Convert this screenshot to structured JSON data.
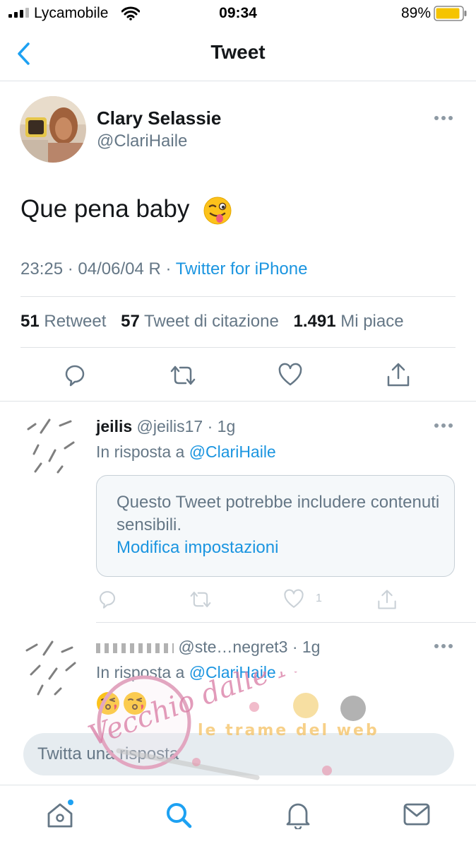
{
  "status_bar": {
    "carrier": "Lycamobile",
    "time": "09:34",
    "battery_percent": "89%",
    "battery_level": 0.89
  },
  "nav": {
    "title": "Tweet"
  },
  "tweet": {
    "author_name": "Clary Selassie",
    "author_handle": "@ClariHaile",
    "text": "Que pena baby",
    "emoji": "winking-face-with-tongue",
    "timestamp": "23:25 · 04/06/04 R · ",
    "source": "Twitter for iPhone",
    "stats": {
      "retweets_count": "51",
      "retweets_label": "Retweet",
      "quotes_count": "57",
      "quotes_label": "Tweet di citazione",
      "likes_count": "1.491",
      "likes_label": "Mi piace"
    }
  },
  "replies": [
    {
      "name": "jeilis",
      "handle_time": "@jeilis17 · 1g",
      "reply_prefix": "In risposta a ",
      "reply_to": "@ClariHaile",
      "sensitive_notice": "Questo Tweet potrebbe includere contenuti sensibili.",
      "sensitive_link": "Modifica impostazioni",
      "like_count": "1"
    },
    {
      "handle_time": "@ste…negret3 · 1g",
      "reply_prefix": "In risposta a ",
      "reply_to": "@ClariHaile",
      "emojis": "face-throwing-kiss x2"
    }
  ],
  "watermark": {
    "left_text": "Vecchio dalle Nuvole",
    "right_text": "le trame del web"
  },
  "compose": {
    "placeholder": "Twitta una risposta"
  },
  "tabs": [
    "home-icon",
    "search-icon",
    "notifications-icon",
    "messages-icon"
  ],
  "colors": {
    "accent": "#1da1f2",
    "link": "#1b95e0",
    "secondary_text": "#657786",
    "divider": "#dfe3e6",
    "battery": "#f5c400"
  }
}
